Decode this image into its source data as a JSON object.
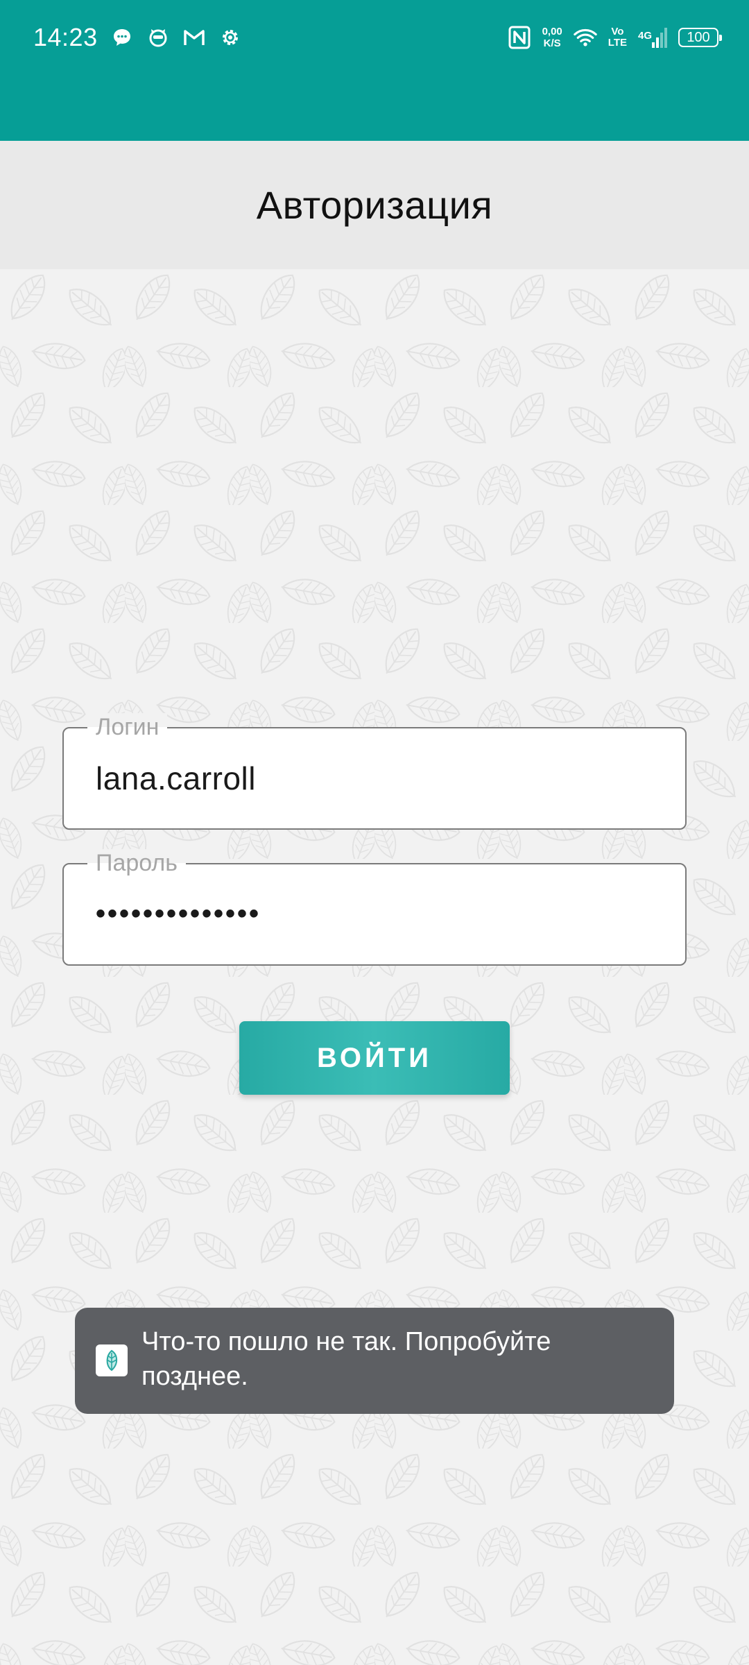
{
  "status_bar": {
    "time": "14:23",
    "left_icons": [
      "message-icon",
      "cat-face-icon",
      "gmail-icon",
      "settings-icon"
    ],
    "nfc_label": "N",
    "net_speed_value": "0,00",
    "net_speed_unit": "K/S",
    "volte_top": "Vo",
    "volte_bottom": "LTE",
    "network_type": "4G",
    "battery_level": "100",
    "background_color": "#069e96"
  },
  "header": {
    "title": "Авторизация",
    "background_color": "#e9e9e9"
  },
  "form": {
    "login": {
      "label": "Логин",
      "value": "lana.carroll"
    },
    "password": {
      "label": "Пароль",
      "value": "••••••••••••••"
    },
    "submit_label": "ВОЙТИ",
    "accent_color": "#31b3ad"
  },
  "toast": {
    "message": "Что-то пошло не так. Попробуйте позднее.",
    "icon": "app-logo-icon",
    "background_color": "#5d5f63"
  }
}
